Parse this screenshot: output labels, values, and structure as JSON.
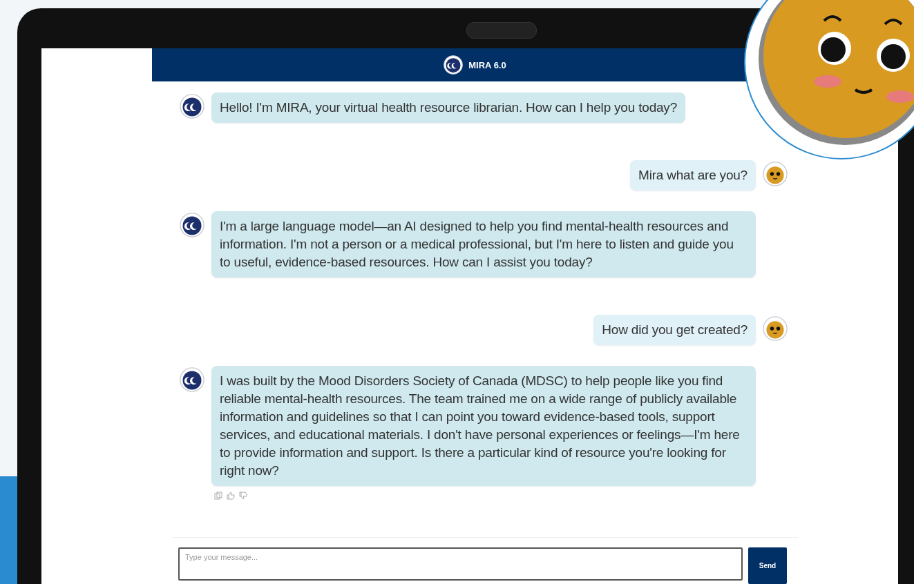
{
  "header": {
    "title": "MIRA 6.0"
  },
  "messages": [
    {
      "kind": "bot",
      "text": "Hello! I'm MIRA, your virtual health resource librarian. How can I help you today?",
      "show_actions": false
    },
    {
      "kind": "user",
      "text": "Mira what are you?",
      "show_actions": false
    },
    {
      "kind": "bot",
      "text": "I'm a large language model—an AI designed to help you find mental-health resources and information. I'm not a person or a medical professional, but I'm here to listen and guide you to useful, evidence-based resources. How can I assist you today?",
      "show_actions": false
    },
    {
      "kind": "user",
      "text": "How did you get created?",
      "show_actions": false
    },
    {
      "kind": "bot",
      "text": "I was built by the Mood Disorders Society of Canada (MDSC) to help people like you find reliable mental-health resources. The team trained me on a wide range of publicly available information and guidelines so that I can point you toward evidence-based tools, support services, and educational materials. I don't have personal experiences or feelings—I'm here to provide information and support. Is there a particular kind of resource you're looking for right now?",
      "show_actions": true
    }
  ],
  "composer": {
    "placeholder": "Type your message...",
    "button": "Send"
  }
}
